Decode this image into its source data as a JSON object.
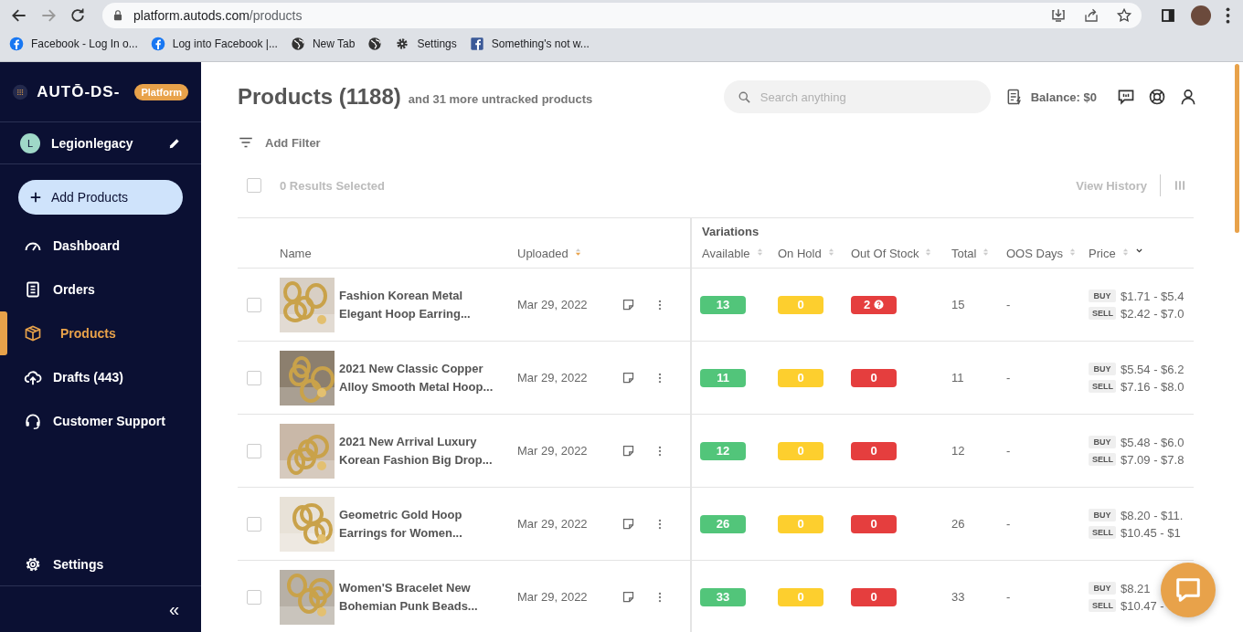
{
  "browser": {
    "url_host": "platform.autods.com",
    "url_path": "/products",
    "bookmarks": [
      {
        "label": "Facebook - Log In o..."
      },
      {
        "label": "Log into Facebook |..."
      },
      {
        "label": "New Tab"
      },
      {
        "label": "Settings"
      },
      {
        "label": "Something's not w..."
      }
    ]
  },
  "sidebar": {
    "logo": "AUTŌ-DS-",
    "badge": "Platform",
    "user": {
      "initial": "L",
      "name": "Legionlegacy"
    },
    "add_button": "Add Products",
    "nav": [
      {
        "label": "Dashboard",
        "selected": false
      },
      {
        "label": "Orders",
        "selected": false
      },
      {
        "label": "Products",
        "selected": true
      },
      {
        "label": "Drafts (443)",
        "selected": false
      },
      {
        "label": "Customer Support",
        "selected": false
      }
    ],
    "settings": "Settings",
    "collapse": "«"
  },
  "header": {
    "title": "Products",
    "count": "(1188)",
    "subtitle": "and 31 more untracked products",
    "search_placeholder": "Search anything",
    "balance": "Balance: $0"
  },
  "toolbar": {
    "select_all_checked": false,
    "filter": "Add Filter",
    "selection": "0 Results Selected",
    "view_history": "View History"
  },
  "table": {
    "group": "Variations",
    "columns": [
      {
        "label": "Name",
        "sortable": false
      },
      {
        "label": "Uploaded",
        "sortable": true,
        "sorted": true
      },
      {
        "label": "Available",
        "sortable": true,
        "sorted": false
      },
      {
        "label": "On Hold",
        "sortable": true,
        "sorted": false
      },
      {
        "label": "Out Of Stock",
        "sortable": true,
        "sorted": false
      },
      {
        "label": "Total",
        "sortable": true,
        "sorted": false
      },
      {
        "label": "OOS Days",
        "sortable": true,
        "sorted": false
      },
      {
        "label": "Price",
        "sortable": true,
        "sorted": false
      }
    ],
    "rows": [
      {
        "checked": false,
        "name": [
          "Fashion Korean Metal",
          "Elegant Hoop Earring..."
        ],
        "uploaded": "Mar 29, 2022",
        "available": "13",
        "on_hold": "0",
        "out_of_stock": "2",
        "oos_info": true,
        "total": "15",
        "oos_days": "-",
        "buy_label": "BUY",
        "buy": "$1.71 - $5.4",
        "sell_label": "SELL",
        "sell": "$2.42 - $7.0"
      },
      {
        "checked": false,
        "name": [
          "2021 New Classic Copper",
          "Alloy Smooth Metal Hoop..."
        ],
        "uploaded": "Mar 29, 2022",
        "available": "11",
        "on_hold": "0",
        "out_of_stock": "0",
        "oos_info": false,
        "total": "11",
        "oos_days": "-",
        "buy_label": "BUY",
        "buy": "$5.54 - $6.2",
        "sell_label": "SELL",
        "sell": "$7.16 - $8.0"
      },
      {
        "checked": false,
        "name": [
          "2021 New Arrival Luxury",
          "Korean Fashion Big Drop..."
        ],
        "uploaded": "Mar 29, 2022",
        "available": "12",
        "on_hold": "0",
        "out_of_stock": "0",
        "oos_info": false,
        "total": "12",
        "oos_days": "-",
        "buy_label": "BUY",
        "buy": "$5.48 - $6.0",
        "sell_label": "SELL",
        "sell": "$7.09 - $7.8"
      },
      {
        "checked": false,
        "name": [
          "Geometric Gold Hoop",
          "Earrings for Women..."
        ],
        "uploaded": "Mar 29, 2022",
        "available": "26",
        "on_hold": "0",
        "out_of_stock": "0",
        "oos_info": false,
        "total": "26",
        "oos_days": "-",
        "buy_label": "BUY",
        "buy": "$8.20 - $11.",
        "sell_label": "SELL",
        "sell": "$10.45 - $1"
      },
      {
        "checked": false,
        "name": [
          "Women'S Bracelet New",
          "Bohemian Punk Beads..."
        ],
        "uploaded": "Mar 29, 2022",
        "available": "33",
        "on_hold": "0",
        "out_of_stock": "0",
        "oos_info": false,
        "total": "33",
        "oos_days": "-",
        "buy_label": "BUY",
        "buy": "$8.21",
        "sell_label": "SELL",
        "sell": "$10.47 -"
      }
    ]
  }
}
